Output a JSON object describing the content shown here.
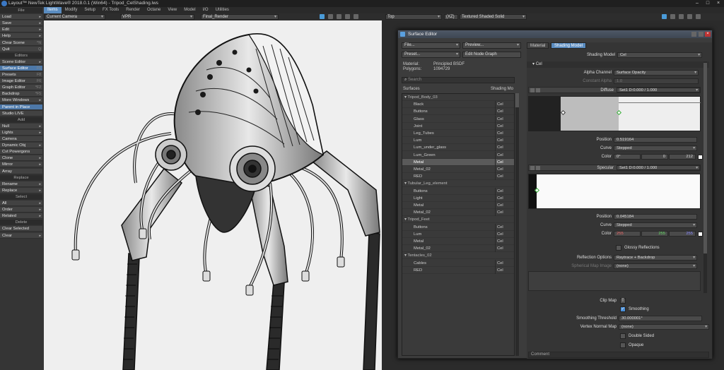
{
  "window": {
    "title": "Layout™ NewTek LightWave® 2018.0.1 (Win64) - Tripod_CelShading.lws"
  },
  "menubar": [
    "Items",
    "Modify",
    "Setup",
    "FX Tools",
    "Render",
    "Octane",
    "View",
    "Model",
    "I/O",
    "Utilities"
  ],
  "left_panel": [
    {
      "label": "File",
      "type": "hdr"
    },
    {
      "label": "Load",
      "arrow": "▸"
    },
    {
      "label": "Save",
      "arrow": "▸"
    },
    {
      "label": "Edit",
      "arrow": "▸"
    },
    {
      "label": "Help",
      "arrow": "▸"
    },
    {
      "label": "Clear Scene",
      "key": "^N"
    },
    {
      "label": "Quit",
      "key": "Q"
    },
    {
      "label": "Editors",
      "type": "hdr"
    },
    {
      "label": "Scene Editor",
      "arrow": "▸"
    },
    {
      "label": "Surface Editor",
      "key": "F5",
      "sel": true
    },
    {
      "label": "Presets",
      "key": "F8"
    },
    {
      "label": "Image Editor",
      "key": "F6"
    },
    {
      "label": "Graph Editor",
      "key": "^F2"
    },
    {
      "label": "Backdrop",
      "key": "^F5"
    },
    {
      "label": "More Windows",
      "arrow": "▸"
    },
    {
      "label": "Parent in Place",
      "sel": true
    },
    {
      "label": "Studio LIVE"
    },
    {
      "label": "Add",
      "type": "hdr"
    },
    {
      "label": "Null",
      "arrow": "▸"
    },
    {
      "label": "Lights",
      "arrow": "▸"
    },
    {
      "label": "Camera"
    },
    {
      "label": "Dynamic Obj",
      "arrow": "▸"
    },
    {
      "label": "Cvt Powergons"
    },
    {
      "label": "Clone",
      "arrow": "▸"
    },
    {
      "label": "Mirror",
      "arrow": "▸"
    },
    {
      "label": "Array"
    },
    {
      "label": "Replace",
      "type": "hdr"
    },
    {
      "label": "Rename",
      "arrow": "▸"
    },
    {
      "label": "Replace",
      "arrow": "▸"
    },
    {
      "label": "Select",
      "type": "hdr"
    },
    {
      "label": "All",
      "arrow": "▸"
    },
    {
      "label": "Order",
      "arrow": "▸"
    },
    {
      "label": "Related",
      "arrow": "▸"
    },
    {
      "label": "Delete",
      "type": "hdr"
    },
    {
      "label": "Clear Selected"
    },
    {
      "label": "Clear",
      "arrow": "▸"
    }
  ],
  "viewport": {
    "camera": "Current Camera",
    "mode": "VPR",
    "buffer": "Final_Render"
  },
  "right_viewport": {
    "view": "Top",
    "zoom": "(XZ)",
    "shading": "Textured Shaded Solid"
  },
  "surface_editor": {
    "title": "Surface Editor",
    "file": "File...",
    "preview": "Preview...",
    "preset": "Preset...",
    "edit_node_graph": "Edit Node Graph",
    "material_label": "Material:",
    "material_value": "Principled BSDF",
    "polygons_label": "Polygons:",
    "polygons_value": "1094729",
    "search_placeholder": "Search",
    "col_surfaces": "Surfaces",
    "col_shading": "Shading Mo",
    "tree": [
      {
        "name": "Tripod_Body_03",
        "grp": true
      },
      {
        "name": "Black",
        "sm": "Cel"
      },
      {
        "name": "Buttons",
        "sm": "Cel"
      },
      {
        "name": "Glass",
        "sm": "Cel"
      },
      {
        "name": "Joint",
        "sm": "Cel"
      },
      {
        "name": "Leg_Tubes",
        "sm": "Cel"
      },
      {
        "name": "Lum",
        "sm": "Cel"
      },
      {
        "name": "Lum_under_glass",
        "sm": "Cel"
      },
      {
        "name": "Lum_Green",
        "sm": "Cel"
      },
      {
        "name": "Metal",
        "sm": "Cel",
        "sel": true
      },
      {
        "name": "Metal_02",
        "sm": "Cel"
      },
      {
        "name": "RED",
        "sm": "Cel"
      },
      {
        "name": "Tubular_Leg_element",
        "grp": true
      },
      {
        "name": "Buttons",
        "sm": "Cel"
      },
      {
        "name": "Light",
        "sm": "Cel"
      },
      {
        "name": "Metal",
        "sm": "Cel"
      },
      {
        "name": "Metal_02",
        "sm": "Cel"
      },
      {
        "name": "Tripod_Feet",
        "grp": true
      },
      {
        "name": "Buttons",
        "sm": "Cel"
      },
      {
        "name": "Lum",
        "sm": "Cel"
      },
      {
        "name": "Metal",
        "sm": "Cel"
      },
      {
        "name": "Metal_02",
        "sm": "Cel"
      },
      {
        "name": "Tentacles_02",
        "grp": true
      },
      {
        "name": "Cables",
        "sm": "Cel"
      },
      {
        "name": "RED",
        "sm": "Cel"
      }
    ],
    "tab_material": "Material",
    "tab_shading": "Shading Model",
    "shading_model_label": "Shading Model",
    "shading_model_value": "Cel",
    "section_cel": "Cel",
    "alpha_channel_label": "Alpha Channel",
    "alpha_channel_value": "Surface Opacity",
    "constant_alpha_label": "Constant Alpha",
    "constant_alpha_value": "1.0",
    "diffuse_label": "Diffuse",
    "diffuse_value": "Set1 D:0.000 / 1.000",
    "pos1_label": "Position",
    "pos1_value": "0.519164",
    "curve1_label": "Curve",
    "curve1_value": "Stepped",
    "color1_label": "Color",
    "color1": [
      "0°",
      "0",
      "212"
    ],
    "specular_label": "Specular",
    "specular_value": "Set1 D:0.000 / 1.000",
    "pos2_label": "Position",
    "pos2_value": "0.045184",
    "curve2_label": "Curve",
    "curve2_value": "Stepped",
    "color2_label": "Color",
    "color2": [
      "255",
      "255",
      "255"
    ],
    "glossy_label": "Glossy Reflections",
    "refl_label": "Reflection Options",
    "refl_value": "Raytrace + Backdrop",
    "sph_label": "Spherical Map Image",
    "sph_value": "(none)",
    "clip_label": "Clip Map",
    "clip_value": "T",
    "smoothing_label": "Smoothing",
    "smooth_thr_label": "Smoothing Threshold",
    "smooth_thr_value": "30.000001°",
    "vnm_label": "Vertex Normal Map",
    "vnm_value": "(none)",
    "double_label": "Double Sided",
    "opaque_label": "Opaque",
    "comment_label": "Comment"
  },
  "colors": {
    "accent": "#5a8cc0",
    "bg": "#3a3a3a"
  }
}
